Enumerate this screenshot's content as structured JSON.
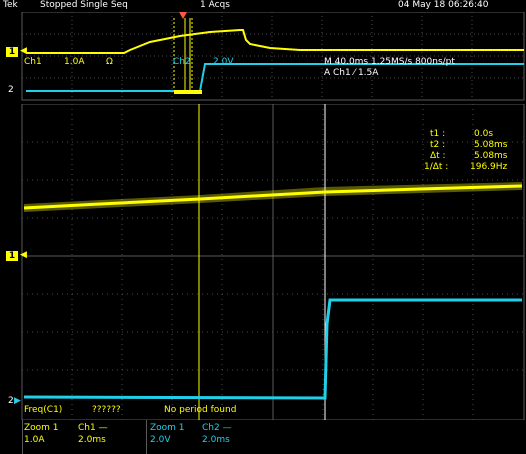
{
  "colors": {
    "ch1": "#ffff00",
    "ch2": "#20d0e8",
    "grid": "#5a5a5a",
    "text": "#ffffff"
  },
  "header": {
    "brand": "Tek",
    "status": "Stopped  Single Seq",
    "acqs": "1 Acqs",
    "datetime": "04 May 18 06:26:40"
  },
  "overview": {
    "ch1_info": {
      "label": "Ch1",
      "scale": "1.0A",
      "coupling": "Ω"
    },
    "ch2_info": {
      "label": "Ch2",
      "scale": "2.0V"
    },
    "timebase": "M 40.0ms 1.25MS/s    800ns/pt",
    "trigger": "A  Ch1  ⁄  1.5A",
    "marker_ch1": "1",
    "marker_ch2": "2"
  },
  "cursors": {
    "t1_label": "t1 :",
    "t1": "0.0s",
    "t2_label": "t2 :",
    "t2": "5.08ms",
    "dt_label": "Δt :",
    "dt": "5.08ms",
    "inv_label": "1/Δt :",
    "inv": "196.9Hz"
  },
  "zoom": {
    "marker_ch1": "1",
    "marker_ch2": "2",
    "freq_label": "Freq(C1)",
    "freq_value": "??????",
    "freq_note": "No period found"
  },
  "bottom": {
    "zoom1_a": "Zoom 1",
    "ch1": "Ch1 —",
    "ch1_scale": "1.0A",
    "ch1_time": "2.0ms",
    "zoom1_b": "Zoom 1",
    "ch2": "Ch2 —",
    "ch2_scale": "2.0V",
    "ch2_time": "2.0ms"
  }
}
